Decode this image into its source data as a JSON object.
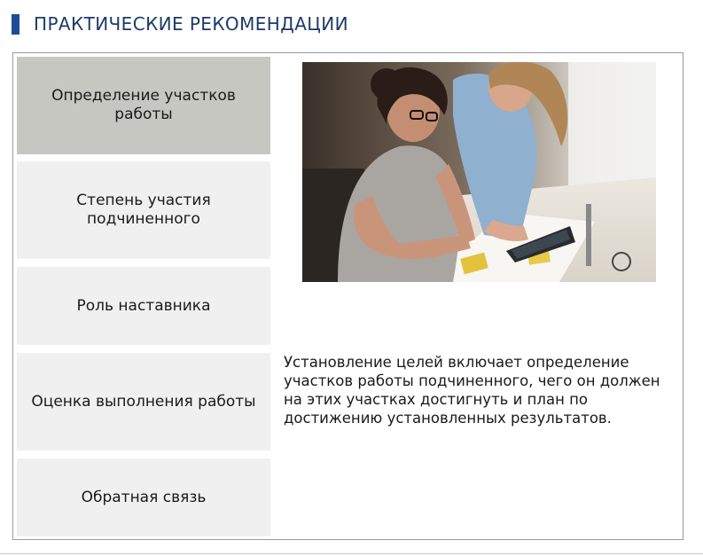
{
  "header": {
    "title": "ПРАКТИЧЕСКИЕ РЕКОМЕНДАЦИИ",
    "accent_color": "#1d4e95"
  },
  "menu": {
    "items": [
      {
        "label": "Определение участков работы",
        "active": true
      },
      {
        "label": "Степень участия подчиненного",
        "active": false
      },
      {
        "label": "Роль наставника",
        "active": false
      },
      {
        "label": "Оценка выполнения работы",
        "active": false
      },
      {
        "label": "Обратная связь",
        "active": false
      }
    ],
    "active_color": "#c6c7c1",
    "inactive_color": "#f0f0f0"
  },
  "content": {
    "image_icon": "photo-two-women-with-tablet",
    "description": "Установление целей включает определение участков работы подчиненного, чего он должен на этих участках достигнуть и план по достижению установленных результатов."
  }
}
